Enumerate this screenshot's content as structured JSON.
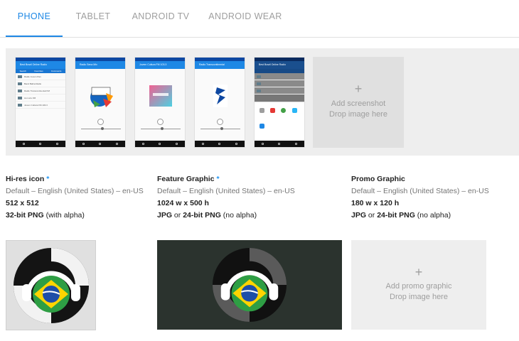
{
  "tabs": [
    {
      "label": "PHONE",
      "active": true
    },
    {
      "label": "TABLET",
      "active": false
    },
    {
      "label": "ANDROID TV",
      "active": false
    },
    {
      "label": "ANDROID WEAR",
      "active": false
    }
  ],
  "screenshots": {
    "items": [
      {
        "app_bar": "Best Brazil Online Radio",
        "tabs": [
          "Search",
          "Favorites",
          "Comments"
        ],
        "rows": [
          "Radio Jovem Pan",
          "Band Bahia Radio",
          "Radio Transcontinental FM",
          "Ao Livre FM",
          "Jovem Cultura FM 103.3"
        ]
      },
      {
        "app_bar": "Radio Sena Mix"
      },
      {
        "app_bar": "Jovem Cultura FM 103.3"
      },
      {
        "app_bar": "Radio Transcontinental"
      },
      {
        "app_bar": "Best Brazil Online Radio",
        "share_apps": [
          "Copy",
          "Gmail",
          "Hangouts",
          "Facebook",
          "Android Beam"
        ]
      }
    ],
    "add": {
      "plus": "+",
      "line1": "Add screenshot",
      "line2": "Drop image here"
    }
  },
  "assets": {
    "hires_icon": {
      "title": "Hi-res icon",
      "required": "*",
      "language": "Default – English (United States) – en-US",
      "dimensions": "512 x 512",
      "format_bold": "32-bit PNG",
      "format_rest": " (with alpha)"
    },
    "feature_graphic": {
      "title": "Feature Graphic",
      "required": "*",
      "language": "Default – English (United States) – en-US",
      "dimensions": "1024 w x 500 h",
      "format_bold1": "JPG",
      "format_or": " or ",
      "format_bold2": "24-bit PNG",
      "format_rest": " (no alpha)"
    },
    "promo_graphic": {
      "title": "Promo Graphic",
      "language": "Default – English (United States) – en-US",
      "dimensions": "180 w x 120 h",
      "format_bold1": "JPG",
      "format_or": " or ",
      "format_bold2": "24-bit PNG",
      "format_rest": " (no alpha)",
      "add": {
        "plus": "+",
        "line1": "Add promo graphic",
        "line2": "Drop image here"
      }
    }
  },
  "colors": {
    "accent": "#1e88e5",
    "app_primary": "#1e88e5",
    "feature_bg": "#2b332e",
    "brazil_green": "#2e9e44",
    "brazil_yellow": "#ffd400",
    "brazil_blue": "#1e4ea8"
  },
  "icons": [
    "brazil-radio-logo-icon",
    "plus-icon",
    "headphones-icon"
  ]
}
